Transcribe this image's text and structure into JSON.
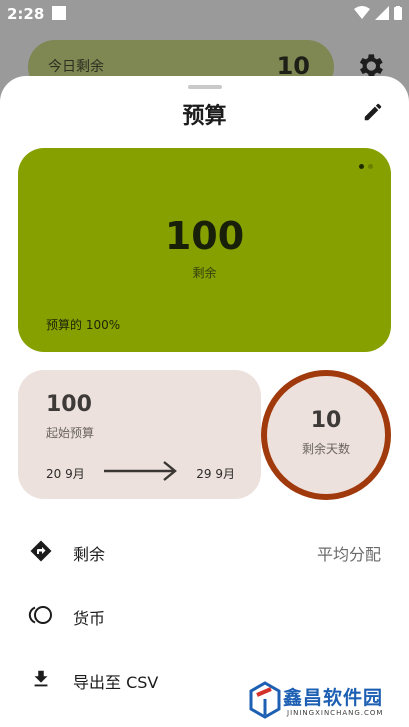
{
  "status_bar": {
    "time": "2:28"
  },
  "background": {
    "today_label": "今日剩余",
    "today_value": "10"
  },
  "sheet": {
    "title": "预算",
    "budget_card": {
      "amount": "100",
      "amount_label": "剩余",
      "percent_text": "预算的 100%"
    },
    "period_card": {
      "start_amount": "100",
      "start_label": "起始预算",
      "start_date": "20 9月",
      "end_date": "29 9月"
    },
    "days_card": {
      "days": "10",
      "days_label": "剩余天数"
    },
    "menu": [
      {
        "label": "剩余",
        "value": "平均分配",
        "icon": "directions-icon"
      },
      {
        "label": "货币",
        "icon": "currency-icon"
      },
      {
        "label": "导出至 CSV",
        "icon": "download-icon"
      }
    ]
  },
  "watermark": {
    "name": "鑫昌软件园",
    "domain": "JININGXINCHANG.COM"
  },
  "colors": {
    "budget_card": "#86a000",
    "period_card": "#ece1dc",
    "days_ring": "#a03a0c"
  }
}
